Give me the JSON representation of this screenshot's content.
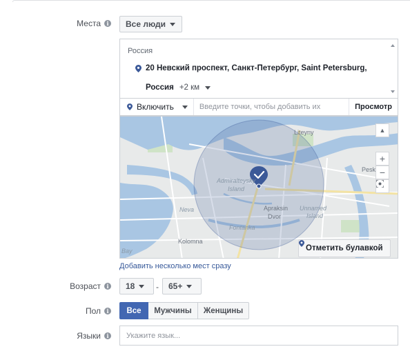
{
  "locations": {
    "label": "Места",
    "audience_selector": "Все люди",
    "country": "Россия",
    "address": "20 Невский проспект, Санкт-Петербург, Saint Petersburg,",
    "address_cont": "Россия",
    "radius": "+2 км",
    "include_label": "Включить",
    "input_placeholder": "Введите точки, чтобы добавить их",
    "browse_label": "Просмотр",
    "drop_pin_label": "Отметить булавкой",
    "bulk_link": "Добавить несколько мест сразу",
    "map": {
      "labels": {
        "admiralteysky": "Admiralteysky",
        "island1": "Island",
        "neva": "Neva",
        "fontanka": "Fontanka",
        "apraksin": "Apraksin",
        "dvor": "Dvor",
        "unnamed": "Unnamed",
        "island2": "Island",
        "kolomna": "Kolomna",
        "liteyny": "Liteyny",
        "pesk": "Pesk",
        "bay": "Bay"
      },
      "zoom_in": "+",
      "zoom_out": "−",
      "colors": {
        "water": "#a9c6e3",
        "land": "#e8eaea",
        "road": "#ffffff",
        "major_road": "#f3e3a4",
        "park": "#cfe3c7",
        "radius_fill": "#3b5998",
        "pin": "#3b5998"
      }
    }
  },
  "age": {
    "label": "Возраст",
    "min": "18",
    "separator": "-",
    "max": "65+"
  },
  "gender": {
    "label": "Пол",
    "options": [
      "Все",
      "Мужчины",
      "Женщины"
    ],
    "selected": "Все"
  },
  "languages": {
    "label": "Языки",
    "placeholder": "Укажите язык..."
  },
  "colors": {
    "accent": "#4267b2",
    "link": "#365899"
  }
}
